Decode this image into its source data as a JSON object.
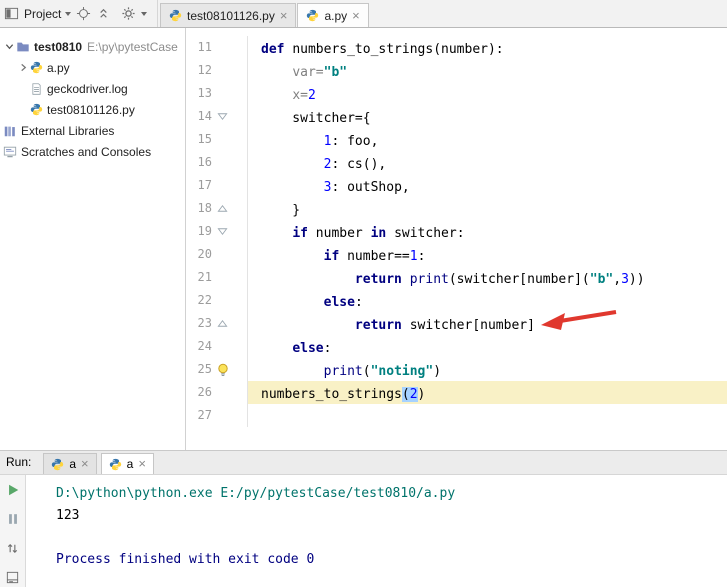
{
  "project_toolbar": {
    "label": "Project"
  },
  "editor_tabs": [
    {
      "label": "test08101126.py",
      "active": false
    },
    {
      "label": "a.py",
      "active": true
    }
  ],
  "project_tree": [
    {
      "label": "test0810",
      "path_suffix": "E:\\py\\pytestCase",
      "icon": "folder-icon",
      "chevron": "down",
      "bold": true,
      "level": 0
    },
    {
      "label": "a.py",
      "icon": "python-icon",
      "chevron": "right",
      "level": 1
    },
    {
      "label": "geckodriver.log",
      "icon": "log-file-icon",
      "chevron": "none",
      "level": 1
    },
    {
      "label": "test08101126.py",
      "icon": "python-icon",
      "chevron": "none",
      "level": 1
    },
    {
      "label": "External Libraries",
      "icon": "library-icon",
      "chevron": "none",
      "level": 0
    },
    {
      "label": "Scratches and Consoles",
      "icon": "scratches-icon",
      "chevron": "none",
      "level": 0
    }
  ],
  "editor": {
    "lines": [
      {
        "num": 11,
        "marker": "",
        "tokens": [
          [
            "def ",
            "kw"
          ],
          [
            "numbers_to_strings(number):",
            "plain"
          ]
        ]
      },
      {
        "num": 12,
        "marker": "",
        "tokens": [
          [
            "    ",
            "plain"
          ],
          [
            "var=",
            "gray"
          ],
          [
            "\"b\"",
            "str"
          ]
        ]
      },
      {
        "num": 13,
        "marker": "",
        "tokens": [
          [
            "    ",
            "plain"
          ],
          [
            "x=",
            "gray"
          ],
          [
            "2",
            "num"
          ]
        ]
      },
      {
        "num": 14,
        "marker": "fold-down",
        "tokens": [
          [
            "    switcher={",
            "plain"
          ]
        ]
      },
      {
        "num": 15,
        "marker": "",
        "tokens": [
          [
            "        ",
            "plain"
          ],
          [
            "1",
            "num"
          ],
          [
            ": foo,",
            "plain"
          ]
        ]
      },
      {
        "num": 16,
        "marker": "",
        "tokens": [
          [
            "        ",
            "plain"
          ],
          [
            "2",
            "num"
          ],
          [
            ": cs(),",
            "plain"
          ]
        ]
      },
      {
        "num": 17,
        "marker": "",
        "tokens": [
          [
            "        ",
            "plain"
          ],
          [
            "3",
            "num"
          ],
          [
            ": outShop,",
            "plain"
          ]
        ]
      },
      {
        "num": 18,
        "marker": "fold-up",
        "tokens": [
          [
            "    }",
            "plain"
          ]
        ]
      },
      {
        "num": 19,
        "marker": "fold-down",
        "tokens": [
          [
            "    ",
            "plain"
          ],
          [
            "if ",
            "kw"
          ],
          [
            "number ",
            "plain"
          ],
          [
            "in ",
            "kw"
          ],
          [
            "switcher:",
            "plain"
          ]
        ]
      },
      {
        "num": 20,
        "marker": "",
        "tokens": [
          [
            "        ",
            "plain"
          ],
          [
            "if ",
            "kw"
          ],
          [
            "number==",
            "plain"
          ],
          [
            "1",
            "num"
          ],
          [
            ":",
            "plain"
          ]
        ]
      },
      {
        "num": 21,
        "marker": "",
        "tokens": [
          [
            "            ",
            "plain"
          ],
          [
            "return ",
            "kw"
          ],
          [
            "print",
            "bi"
          ],
          [
            "(switcher[number](",
            "plain"
          ],
          [
            "\"b\"",
            "str"
          ],
          [
            ",",
            "plain"
          ],
          [
            "3",
            "num"
          ],
          [
            "))",
            "plain"
          ]
        ]
      },
      {
        "num": 22,
        "marker": "",
        "tokens": [
          [
            "        ",
            "plain"
          ],
          [
            "else",
            "kw"
          ],
          [
            ":",
            "plain"
          ]
        ]
      },
      {
        "num": 23,
        "marker": "fold-up",
        "tokens": [
          [
            "            ",
            "plain"
          ],
          [
            "return ",
            "kw"
          ],
          [
            "switcher[number]",
            "plain"
          ]
        ]
      },
      {
        "num": 24,
        "marker": "",
        "tokens": [
          [
            "    ",
            "plain"
          ],
          [
            "else",
            "kw"
          ],
          [
            ":",
            "plain"
          ]
        ]
      },
      {
        "num": 25,
        "marker": "bulb",
        "tokens": [
          [
            "        ",
            "plain"
          ],
          [
            "print",
            "bi"
          ],
          [
            "(",
            "plain"
          ],
          [
            "\"noting\"",
            "str"
          ],
          [
            ")",
            "plain"
          ]
        ]
      },
      {
        "num": 26,
        "marker": "",
        "highlight": true,
        "tokens": [
          [
            "numbers_to_strings",
            "plain"
          ],
          [
            "(",
            "sel"
          ],
          [
            "2",
            "selnum"
          ],
          [
            ")",
            "plain"
          ]
        ]
      },
      {
        "num": 27,
        "marker": "",
        "tokens": []
      }
    ],
    "annotation_arrow": {
      "target_line": 23,
      "color": "#E0382E"
    }
  },
  "run_panel": {
    "label": "Run:",
    "tabs": [
      {
        "label": "a",
        "active": false
      },
      {
        "label": "a",
        "active": true
      }
    ],
    "console": [
      {
        "text": "D:\\python\\python.exe E:/py/pytestCase/test0810/a.py",
        "style": "command"
      },
      {
        "text": "123",
        "style": "plain"
      },
      {
        "text": "",
        "style": "plain"
      },
      {
        "text": "Process finished with exit code 0",
        "style": "info"
      }
    ]
  },
  "colors": {
    "keyword": "#000080",
    "string": "#008080",
    "number": "#0000FF",
    "caret_row": "#F9F1C6",
    "selection": "#A6D2FF",
    "console_command": "#00736B",
    "console_info": "#000080",
    "arrow_red": "#E0382E"
  }
}
